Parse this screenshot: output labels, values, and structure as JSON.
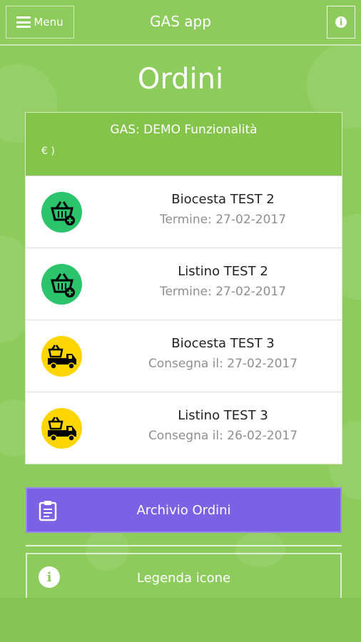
{
  "topbar": {
    "menu_label": "Menu",
    "app_title": "GAS app",
    "info_glyph": "i"
  },
  "page": {
    "title": "Ordini"
  },
  "card": {
    "gas_name": "GAS: DEMO Funzionalità",
    "gas_sub": "€ )",
    "orders": [
      {
        "name": "Biocesta TEST 2",
        "date": "Termine: 27-02-2017",
        "icon": "basket-plus-icon",
        "color": "#2bc46c"
      },
      {
        "name": "Listino TEST 2",
        "date": "Termine: 27-02-2017",
        "icon": "basket-plus-icon",
        "color": "#2bc46c"
      },
      {
        "name": "Biocesta TEST 3",
        "date": "Consegna il: 27-02-2017",
        "icon": "delivery-truck-icon",
        "color": "#ffd500"
      },
      {
        "name": "Listino TEST 3",
        "date": "Consegna il: 26-02-2017",
        "icon": "delivery-truck-icon",
        "color": "#ffd500"
      }
    ]
  },
  "buttons": {
    "archive_label": "Archivio Ordini",
    "legend_label": "Legenda icone",
    "legend_glyph": "i"
  },
  "colors": {
    "green": "#8ecb5d",
    "header_green": "#84c44a",
    "purple": "#7b61e4"
  }
}
